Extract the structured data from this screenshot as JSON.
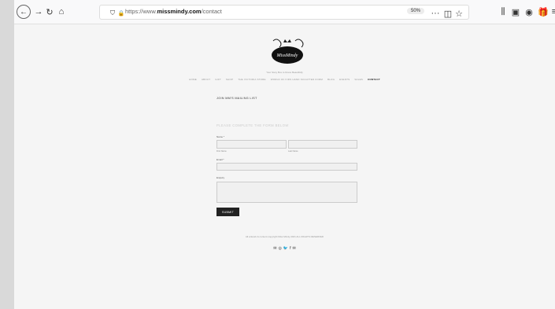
{
  "browser": {
    "url_prefix": "https://www.",
    "url_domain": "missmindy.com",
    "url_path": "/contact",
    "zoom": "50%"
  },
  "site": {
    "logo_text": "MissMindy",
    "tagline": "Your Story Box to Dress Beautifully",
    "nav": [
      "HOME",
      "ABOUT",
      "GIFT",
      "SHOP",
      "THE VICTORIA STORE",
      "WORLD OF KIDS HAND SCULPTED FORM",
      "BLOG",
      "EVENTS",
      "SALES",
      "CONTACT"
    ]
  },
  "main": {
    "heading": "JOIN MM'S MAILING LIST",
    "subheading": "PLEASE COMPLETE THE FORM BELOW",
    "name_label": "Name *",
    "first_name_label": "First Name",
    "last_name_label": "Last Name",
    "email_label": "Email *",
    "enquiry_label": "Enquiry",
    "submit_label": "SUBMIT"
  },
  "footer": {
    "text": "All artwork & content copyright Miss Mindy 2021 ALL RIGHTS RESERVED",
    "social": [
      "email-icon",
      "instagram-icon",
      "twitter-icon",
      "facebook-icon",
      "email-icon"
    ]
  },
  "colors": {
    "active_nav": "#222222",
    "button": "#222222",
    "page_bg": "#f5f5f5"
  }
}
